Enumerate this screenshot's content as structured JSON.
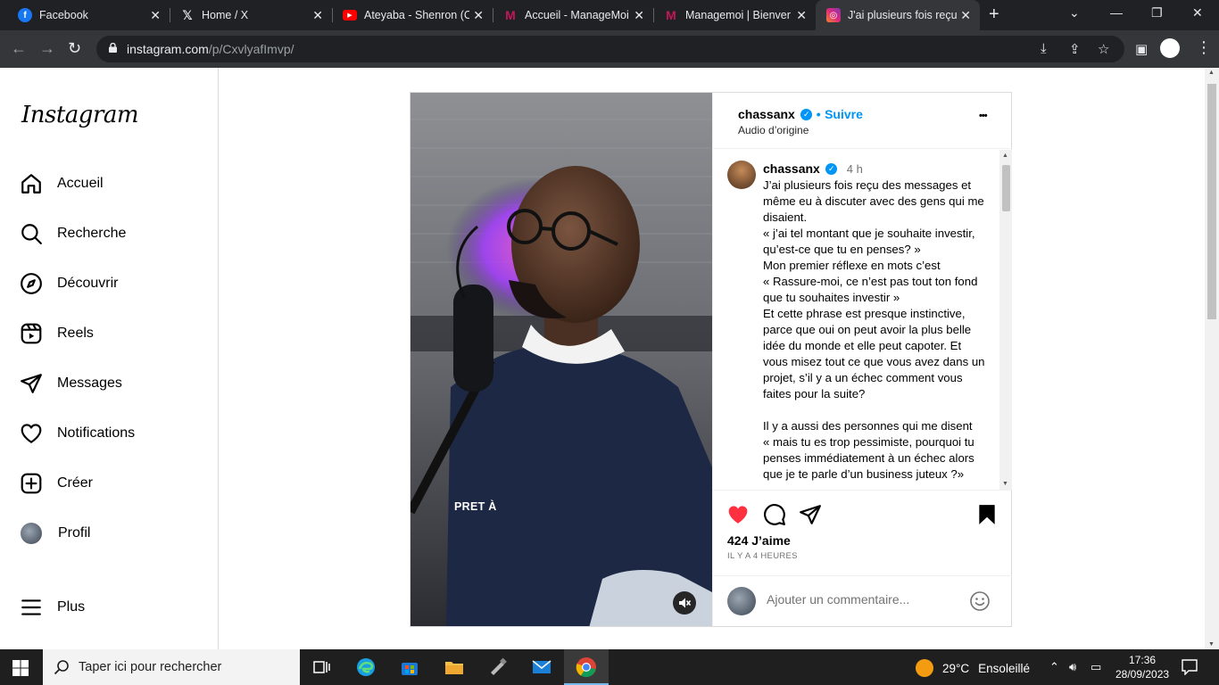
{
  "browser": {
    "tabs": [
      {
        "title": "Facebook",
        "icon": "facebook-icon",
        "color": "#1877f2"
      },
      {
        "title": "Home / X",
        "icon": "x-icon",
        "color": "#000000"
      },
      {
        "title": "Ateyaba - Shenron (C",
        "icon": "youtube-icon",
        "color": "#ff0000"
      },
      {
        "title": "Accueil - ManageMoi",
        "icon": "managemoi-icon",
        "color": "#b0145a"
      },
      {
        "title": "Managemoi | Bienven",
        "icon": "managemoi-icon",
        "color": "#b0145a"
      },
      {
        "title": "J'ai plusieurs fois reçu",
        "icon": "instagram-icon",
        "color": "#e1306c"
      }
    ],
    "url_domain": "instagram.com",
    "url_path": "/p/CxvlyafImvp/"
  },
  "sidebar": {
    "logo": "Instagram",
    "items": [
      {
        "label": "Accueil",
        "icon": "home-icon"
      },
      {
        "label": "Recherche",
        "icon": "search-icon"
      },
      {
        "label": "Découvrir",
        "icon": "compass-icon"
      },
      {
        "label": "Reels",
        "icon": "reels-icon"
      },
      {
        "label": "Messages",
        "icon": "send-icon"
      },
      {
        "label": "Notifications",
        "icon": "heart-icon"
      },
      {
        "label": "Créer",
        "icon": "plus-square-icon"
      },
      {
        "label": "Profil",
        "icon": "avatar"
      },
      {
        "label": "Plus",
        "icon": "menu-icon"
      }
    ]
  },
  "post": {
    "username": "chassanx",
    "follow_label": "Suivre",
    "separator": "•",
    "audio": "Audio d’origine",
    "more": "•••",
    "video_overlay_text": "PRET À",
    "caption": {
      "username": "chassanx",
      "time": "4 h",
      "text": "J’ai plusieurs fois reçu des messages et même eu à discuter avec des gens qui me disaient.\n« j’ai tel montant que je souhaite investir, qu’est-ce que tu en penses? »\nMon premier réflexe en mots c’est\n« Rassure-moi, ce n’est pas tout ton fond que tu souhaites investir »\nEt cette phrase est presque instinctive, parce que oui on peut avoir la plus belle idée du monde et elle peut capoter. Et vous misez tout ce que vous avez dans un projet, s’il y a un échec comment vous faites pour la suite?\n\nIl y a aussi des personnes qui me disent\n« mais tu es trop pessimiste, pourquoi tu penses immédiatement à un échec alors que je te parle d’un business juteux ?»"
    },
    "likes": "424 J’aime",
    "time_ago": "IL Y A 4 HEURES",
    "comment_placeholder": "Ajouter un commentaire...",
    "liked": true,
    "saved": true
  },
  "taskbar": {
    "search_placeholder": "Taper ici pour rechercher",
    "weather_temp": "29°C",
    "weather_desc": "Ensoleillé",
    "time": "17:36",
    "date": "28/09/2023"
  },
  "colors": {
    "accent_blue": "#0095f6",
    "like_red": "#ff3040"
  }
}
